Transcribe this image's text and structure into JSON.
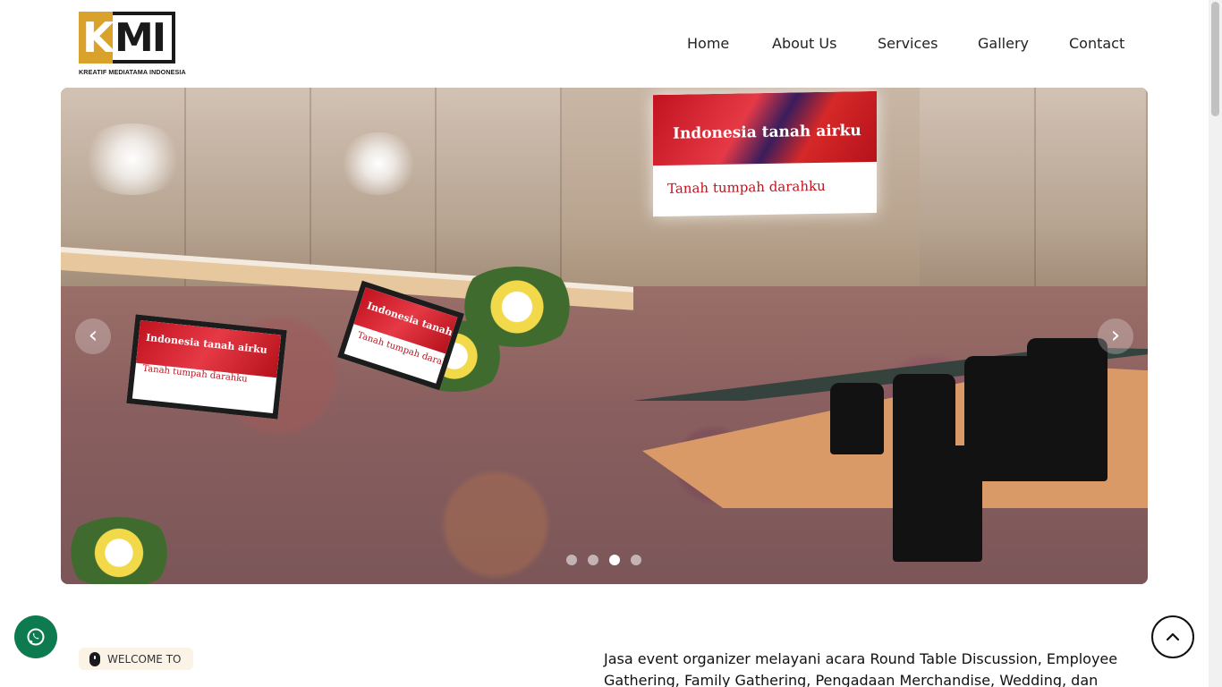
{
  "header": {
    "logo": {
      "mark": "KMI",
      "tagline": "KREATIF MEDIATAMA INDONESIA",
      "colors": {
        "gold": "#d9a22a",
        "dark": "#1a1a1a"
      }
    },
    "nav": [
      {
        "label": "Home"
      },
      {
        "label": "About Us"
      },
      {
        "label": "Services"
      },
      {
        "label": "Gallery"
      },
      {
        "label": "Contact"
      }
    ]
  },
  "carousel": {
    "slide_count": 4,
    "active_slide": 3,
    "screen_text": {
      "line1": "Indonesia tanah airku",
      "line2": "Tanah tumpah darahku"
    },
    "prev_icon": "chevron-left-icon",
    "next_icon": "chevron-right-icon"
  },
  "welcome": {
    "badge": "WELCOME TO",
    "intro": "Jasa event organizer melayani acara Round Table Discussion, Employee Gathering, Family Gathering, Pengadaan Merchandise, Wedding, dan"
  },
  "floating": {
    "whatsapp_icon": "whatsapp-icon",
    "whatsapp_color": "#0d7a4f",
    "back_to_top_icon": "chevron-up-icon"
  }
}
